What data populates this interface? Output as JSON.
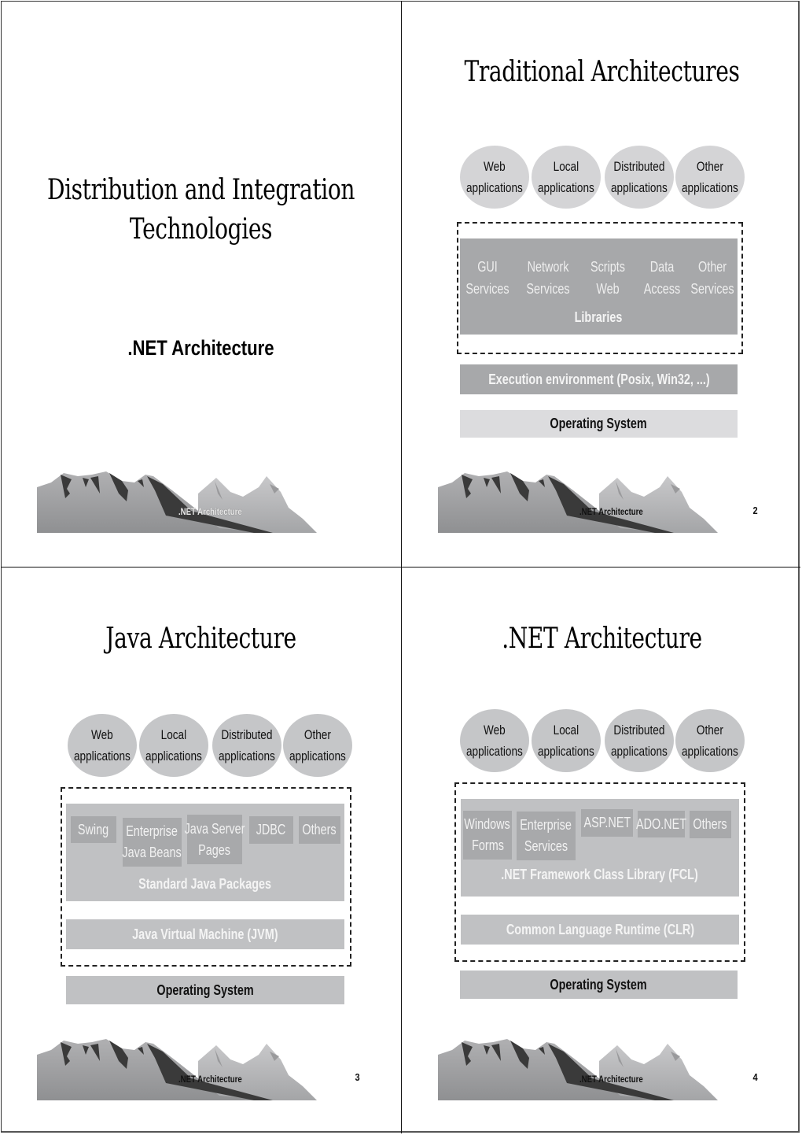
{
  "footer_label": ".NET Architecture",
  "slides": [
    {
      "title_line1": "Distribution and Integration",
      "title_line2": "Technologies",
      "subtitle": ".NET Architecture",
      "page_number": ""
    },
    {
      "title": "Traditional Architectures",
      "applications": [
        [
          "Web",
          "applications"
        ],
        [
          "Local",
          "applications"
        ],
        [
          "Distributed",
          "applications"
        ],
        [
          "Other",
          "applications"
        ]
      ],
      "libraries": [
        [
          "GUI",
          "Services"
        ],
        [
          "Network",
          "Services"
        ],
        [
          "Scripts",
          "Web"
        ],
        [
          "Data",
          "Access"
        ],
        [
          "Other",
          "Services"
        ]
      ],
      "libraries_label": "Libraries",
      "execution_environment": "Execution environment (Posix, Win32, ...)",
      "operating_system": "Operating System",
      "page_number": "2"
    },
    {
      "title": "Java Architecture",
      "applications": [
        [
          "Web",
          "applications"
        ],
        [
          "Local",
          "applications"
        ],
        [
          "Distributed",
          "applications"
        ],
        [
          "Other",
          "applications"
        ]
      ],
      "packages": [
        [
          "Swing"
        ],
        [
          "Enterprise",
          "Java Beans"
        ],
        [
          "Java Server",
          "Pages"
        ],
        [
          "JDBC"
        ],
        [
          "Others"
        ]
      ],
      "packages_label": "Standard Java Packages",
      "jvm": "Java Virtual Machine (JVM)",
      "operating_system": "Operating System",
      "page_number": "3"
    },
    {
      "title": ".NET Architecture",
      "applications": [
        [
          "Web",
          "applications"
        ],
        [
          "Local",
          "applications"
        ],
        [
          "Distributed",
          "applications"
        ],
        [
          "Other",
          "applications"
        ]
      ],
      "fcl_items": [
        [
          "Windows",
          "Forms"
        ],
        [
          "Enterprise",
          "Services"
        ],
        [
          "ASP.NET"
        ],
        [
          "ADO.NET"
        ],
        [
          "Others"
        ]
      ],
      "fcl_label": ".NET Framework Class Library (FCL)",
      "clr": "Common Language Runtime (CLR)",
      "operating_system": "Operating System",
      "page_number": "4"
    }
  ]
}
